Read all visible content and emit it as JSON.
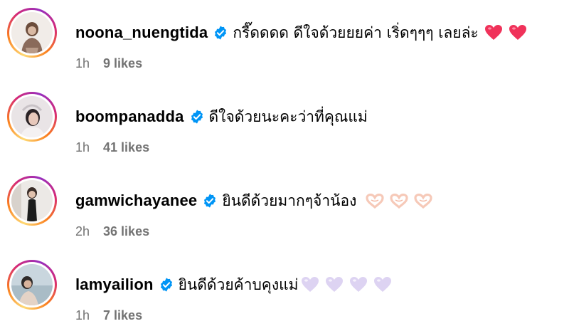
{
  "comments": [
    {
      "username": "noona_nuengtida",
      "text": "กรี๊ดดดด ดีใจด้วยยยค่า เริ่ดๆๆๆ เลยล่ะ",
      "emoji": [
        "red-heart",
        "red-heart"
      ],
      "time": "1h",
      "likes": "9 likes"
    },
    {
      "username": "boompanadda",
      "text": "ดีใจด้วยนะคะว่าที่คุณแม่",
      "emoji": [],
      "time": "1h",
      "likes": "41 likes"
    },
    {
      "username": "gamwichayanee",
      "text": "ยินดีด้วยมากๆจ้าน้อง",
      "emoji": [
        "heart-hands",
        "heart-hands",
        "heart-hands"
      ],
      "time": "2h",
      "likes": "36 likes"
    },
    {
      "username": "lamyailion",
      "text": "ยินดีด้วยค้าบคุงแม่",
      "emoji": [
        "white-heart",
        "white-heart",
        "white-heart",
        "white-heart"
      ],
      "time": "1h",
      "likes": "7 likes"
    }
  ],
  "colors": {
    "verified_badge": "#0095f6",
    "meta_text": "#737373",
    "red_heart": "#f0325a",
    "white_heart": "#ddd3f2",
    "heart_hands": "#f6c9b8"
  }
}
